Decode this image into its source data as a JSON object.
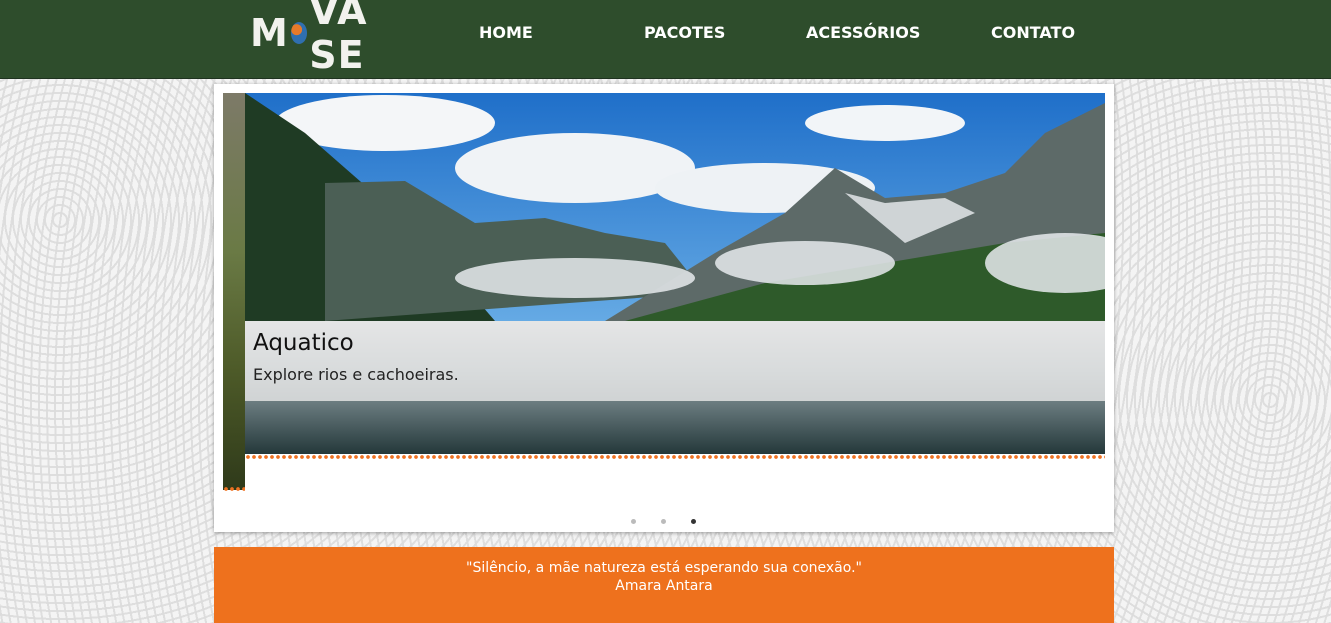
{
  "header": {
    "logo_text_left": "M",
    "logo_text_right": "VA SE",
    "nav": [
      {
        "label": "HOME"
      },
      {
        "label": "PACOTES"
      },
      {
        "label": "ACESSÓRIOS"
      },
      {
        "label": "CONTATO"
      }
    ]
  },
  "carousel": {
    "slide_title": "Aquatico",
    "slide_text": "Explore rios e cachoeiras.",
    "indicators": 3,
    "active_indicator": 3
  },
  "quote": {
    "text": "\"Silêncio, a mãe natureza está esperando sua conexão.\"",
    "author": "Amara Antara"
  },
  "colors": {
    "header_bg": "#2e4d2c",
    "accent_orange": "#ee711d"
  },
  "icons": [
    "globe-icon",
    "next-arrow-icon"
  ]
}
